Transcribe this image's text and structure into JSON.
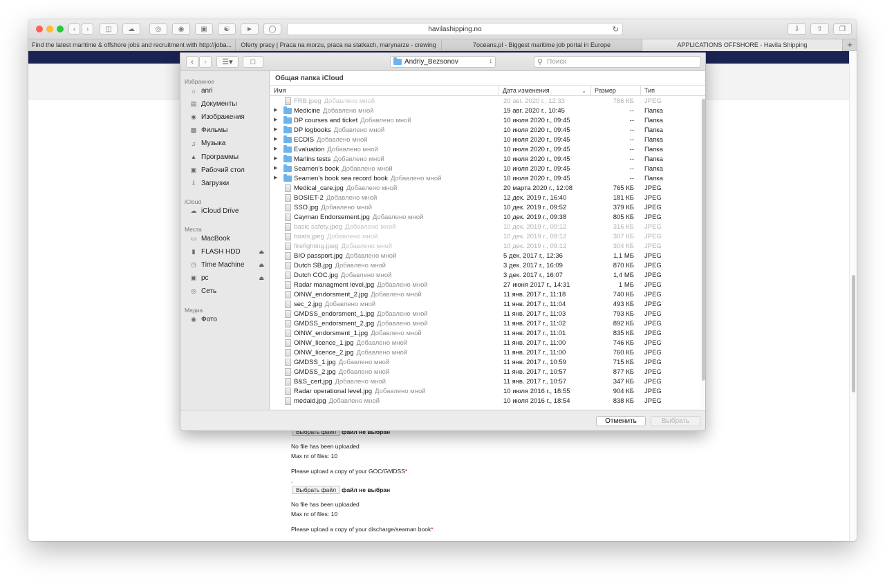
{
  "browser": {
    "url": "havilashipping.no",
    "tabs": [
      {
        "label": "Find the latest maritime & offshore jobs and recruitment with http://joba..."
      },
      {
        "label": "Oferty pracy | Praca na morzu, praca na statkach, marynarze - crewing"
      },
      {
        "label": "7oceans.pl - Biggest maritime job portal in Europe"
      },
      {
        "label": "APPLICATIONS OFFSHORE - Havila Shipping"
      }
    ],
    "active_tab": 3,
    "colors": {
      "red": "#fe5f57",
      "yellow": "#febc2e",
      "green": "#28c840",
      "header_band": "#1b2354"
    }
  },
  "page": {
    "choose_file": "Выбрать файл",
    "no_file_chosen": "файл не выбран",
    "no_file_uploaded": "No file has been uploaded",
    "max_files": "Max nr of files: 10",
    "goc_prompt": "Please upload a copy of your GOC/GMDSS",
    "discharge_prompt": "Please upload a copy of your discharge/seaman book",
    "required_mark": "*",
    "dot": "."
  },
  "dialog": {
    "location": "Andriy_Bezsonov",
    "search_placeholder": "Поиск",
    "list_title": "Общая папка iCloud",
    "columns": {
      "name": "Имя",
      "date": "Дата изменения",
      "size": "Размер",
      "kind": "Тип"
    },
    "cancel": "Отменить",
    "choose": "Выбрать",
    "sidebar": {
      "favorites_header": "Избранное",
      "favorites": [
        {
          "label": "anri",
          "icon": "home-icon"
        },
        {
          "label": "Документы",
          "icon": "documents-icon"
        },
        {
          "label": "Изображения",
          "icon": "camera-icon"
        },
        {
          "label": "Фильмы",
          "icon": "film-icon"
        },
        {
          "label": "Музыка",
          "icon": "music-icon"
        },
        {
          "label": "Программы",
          "icon": "applications-icon"
        },
        {
          "label": "Рабочий стол",
          "icon": "desktop-icon"
        },
        {
          "label": "Загрузки",
          "icon": "downloads-icon"
        }
      ],
      "icloud_header": "iCloud",
      "icloud": [
        {
          "label": "iCloud Drive",
          "icon": "cloud-icon"
        }
      ],
      "places_header": "Места",
      "places": [
        {
          "label": "MacBook",
          "icon": "laptop-icon",
          "eject": false
        },
        {
          "label": "FLASH HDD",
          "icon": "drive-icon",
          "eject": true
        },
        {
          "label": "Time Machine",
          "icon": "time-machine-icon",
          "eject": true
        },
        {
          "label": "pc",
          "icon": "disk-icon",
          "eject": true
        },
        {
          "label": "Сеть",
          "icon": "network-icon",
          "eject": false
        }
      ],
      "media_header": "Медиа",
      "media": [
        {
          "label": "Фото",
          "icon": "camera-icon"
        }
      ]
    },
    "added_by_me": "Добавлено мной",
    "files": [
      {
        "name": "FRB.jpeg",
        "date": "20 авг. 2020 г., 12:33",
        "size": "786 КБ",
        "kind": "JPEG",
        "folder": false,
        "dim": true
      },
      {
        "name": "Medicine",
        "date": "19 авг. 2020 г., 10:45",
        "size": "--",
        "kind": "Папка",
        "folder": true,
        "dim": false
      },
      {
        "name": "DP courses and ticket",
        "date": "10 июля 2020 г., 09:45",
        "size": "--",
        "kind": "Папка",
        "folder": true,
        "dim": false
      },
      {
        "name": "DP logbooks",
        "date": "10 июля 2020 г., 09:45",
        "size": "--",
        "kind": "Папка",
        "folder": true,
        "dim": false
      },
      {
        "name": "ECDIS",
        "date": "10 июля 2020 г., 09:45",
        "size": "--",
        "kind": "Папка",
        "folder": true,
        "dim": false
      },
      {
        "name": "Evaluation",
        "date": "10 июля 2020 г., 09:45",
        "size": "--",
        "kind": "Папка",
        "folder": true,
        "dim": false
      },
      {
        "name": "Marlins tests",
        "date": "10 июля 2020 г., 09:45",
        "size": "--",
        "kind": "Папка",
        "folder": true,
        "dim": false
      },
      {
        "name": "Seamen's book",
        "date": "10 июля 2020 г., 09:45",
        "size": "--",
        "kind": "Папка",
        "folder": true,
        "dim": false
      },
      {
        "name": "Seamen's book sea record book",
        "date": "10 июля 2020 г., 09:45",
        "size": "--",
        "kind": "Папка",
        "folder": true,
        "dim": false
      },
      {
        "name": "Medical_care.jpg",
        "date": "20 марта 2020 г., 12:08",
        "size": "765 КБ",
        "kind": "JPEG",
        "folder": false,
        "dim": false
      },
      {
        "name": "BOSIET-2",
        "date": "12 дек. 2019 г., 16:40",
        "size": "181 КБ",
        "kind": "JPEG",
        "folder": false,
        "dim": false
      },
      {
        "name": "SSO.jpg",
        "date": "10 дек. 2019 г., 09:52",
        "size": "379 КБ",
        "kind": "JPEG",
        "folder": false,
        "dim": false
      },
      {
        "name": "Cayman Endorsement.jpg",
        "date": "10 дек. 2019 г., 09:38",
        "size": "805 КБ",
        "kind": "JPEG",
        "folder": false,
        "dim": false
      },
      {
        "name": "basic safety.jpeg",
        "date": "10 дек. 2019 г., 09:12",
        "size": "316 КБ",
        "kind": "JPEG",
        "folder": false,
        "dim": true
      },
      {
        "name": "boats.jpeg",
        "date": "10 дек. 2019 г., 09:12",
        "size": "307 КБ",
        "kind": "JPEG",
        "folder": false,
        "dim": true
      },
      {
        "name": "firefighting.jpeg",
        "date": "10 дек. 2019 г., 09:12",
        "size": "304 КБ",
        "kind": "JPEG",
        "folder": false,
        "dim": true
      },
      {
        "name": "BIO passport.jpg",
        "date": "5 дек. 2017 г., 12:36",
        "size": "1,1 МБ",
        "kind": "JPEG",
        "folder": false,
        "dim": false
      },
      {
        "name": "Dutch SB.jpg",
        "date": "3 дек. 2017 г., 16:09",
        "size": "870 КБ",
        "kind": "JPEG",
        "folder": false,
        "dim": false
      },
      {
        "name": "Dutch COC.jpg",
        "date": "3 дек. 2017 г., 16:07",
        "size": "1,4 МБ",
        "kind": "JPEG",
        "folder": false,
        "dim": false
      },
      {
        "name": "Radar managment level.jpg",
        "date": "27 июня 2017 г., 14:31",
        "size": "1 МБ",
        "kind": "JPEG",
        "folder": false,
        "dim": false
      },
      {
        "name": "OINW_endorsment_2.jpg",
        "date": "11 янв. 2017 г., 11:18",
        "size": "740 КБ",
        "kind": "JPEG",
        "folder": false,
        "dim": false
      },
      {
        "name": "sec_2.jpg",
        "date": "11 янв. 2017 г., 11:04",
        "size": "493 КБ",
        "kind": "JPEG",
        "folder": false,
        "dim": false
      },
      {
        "name": "GMDSS_endorsment_1.jpg",
        "date": "11 янв. 2017 г., 11:03",
        "size": "793 КБ",
        "kind": "JPEG",
        "folder": false,
        "dim": false
      },
      {
        "name": "GMDSS_endorsment_2.jpg",
        "date": "11 янв. 2017 г., 11:02",
        "size": "892 КБ",
        "kind": "JPEG",
        "folder": false,
        "dim": false
      },
      {
        "name": "OINW_endorsment_1.jpg",
        "date": "11 янв. 2017 г., 11:01",
        "size": "835 КБ",
        "kind": "JPEG",
        "folder": false,
        "dim": false
      },
      {
        "name": "OINW_licence_1.jpg",
        "date": "11 янв. 2017 г., 11:00",
        "size": "746 КБ",
        "kind": "JPEG",
        "folder": false,
        "dim": false
      },
      {
        "name": "OINW_licence_2.jpg",
        "date": "11 янв. 2017 г., 11:00",
        "size": "760 КБ",
        "kind": "JPEG",
        "folder": false,
        "dim": false
      },
      {
        "name": "GMDSS_1.jpg",
        "date": "11 янв. 2017 г., 10:59",
        "size": "715 КБ",
        "kind": "JPEG",
        "folder": false,
        "dim": false
      },
      {
        "name": "GMDSS_2.jpg",
        "date": "11 янв. 2017 г., 10:57",
        "size": "877 КБ",
        "kind": "JPEG",
        "folder": false,
        "dim": false
      },
      {
        "name": "B&S_cert.jpg",
        "date": "11 янв. 2017 г., 10:57",
        "size": "347 КБ",
        "kind": "JPEG",
        "folder": false,
        "dim": false
      },
      {
        "name": "Radar operational level.jpg",
        "date": "10 июля 2016 г., 18:55",
        "size": "904 КБ",
        "kind": "JPEG",
        "folder": false,
        "dim": false
      },
      {
        "name": "medaid.jpg",
        "date": "10 июля 2016 г., 18:54",
        "size": "838 КБ",
        "kind": "JPEG",
        "folder": false,
        "dim": false
      }
    ]
  }
}
